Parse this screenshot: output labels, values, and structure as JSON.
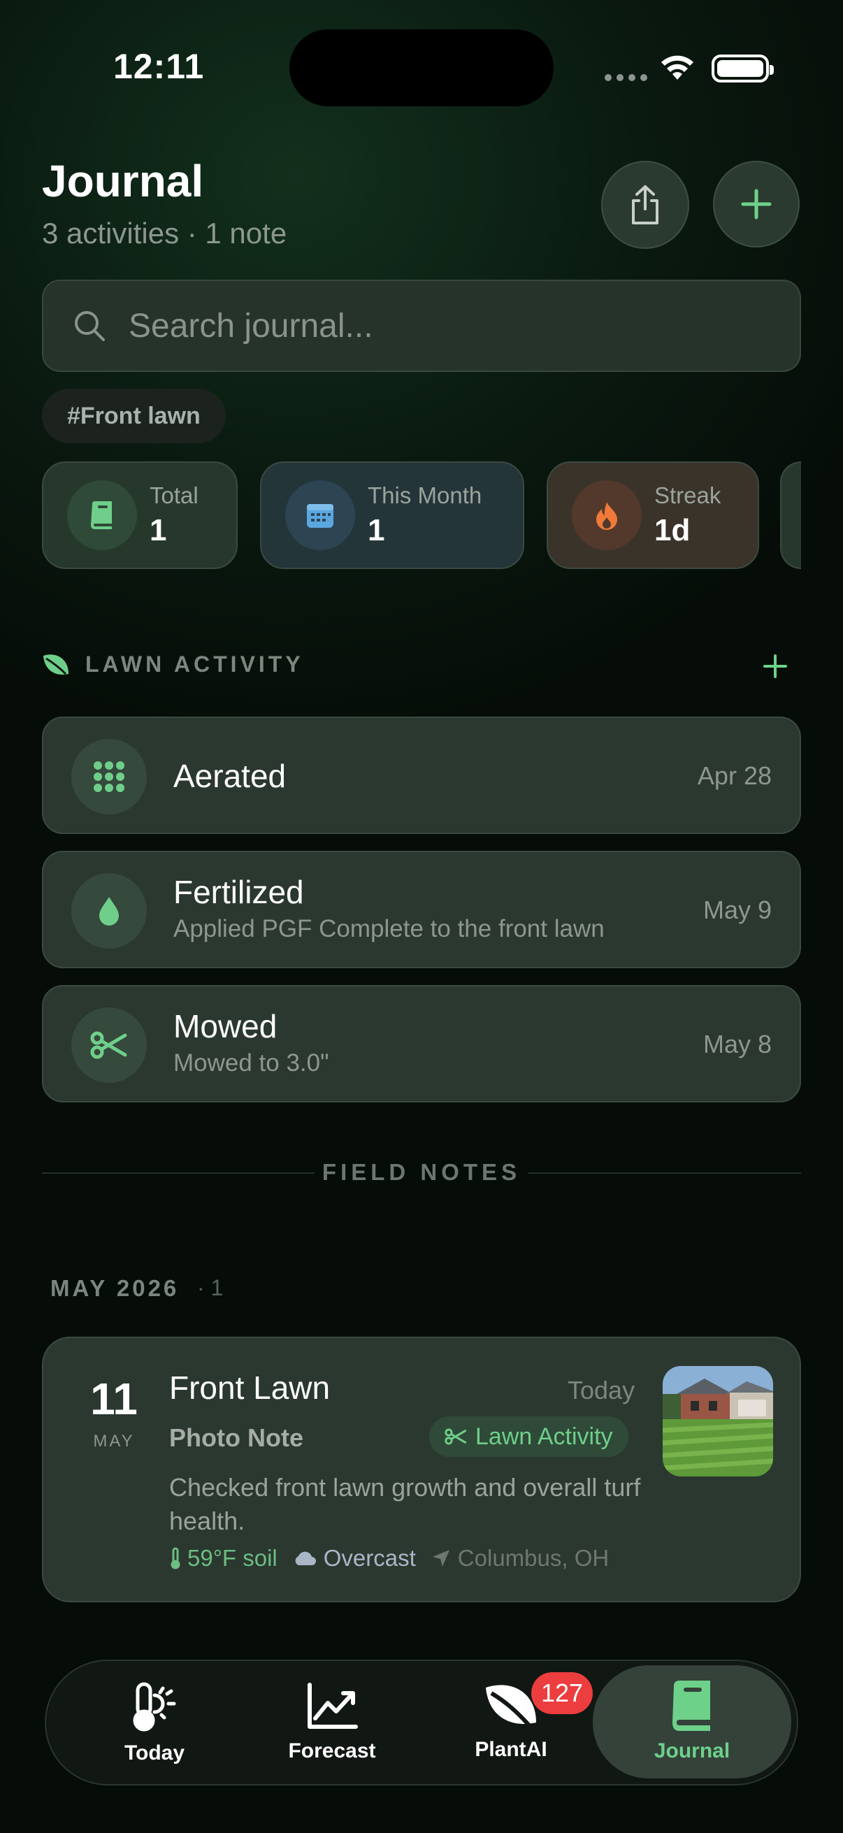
{
  "status_bar": {
    "time": "12:11"
  },
  "header": {
    "title": "Journal",
    "subtitle": "3 activities · 1 note"
  },
  "search": {
    "placeholder": "Search journal..."
  },
  "filter_tag": "#Front lawn",
  "stats": [
    {
      "label": "Total",
      "value": "1",
      "icon": "book-icon",
      "color": "#6fcf8a"
    },
    {
      "label": "This Month",
      "value": "1",
      "icon": "calendar-icon",
      "color": "#5aa7e0"
    },
    {
      "label": "Streak",
      "value": "1d",
      "icon": "flame-icon",
      "color": "#f07a3a"
    }
  ],
  "lawn_activity": {
    "title": "LAWN ACTIVITY",
    "items": [
      {
        "name": "Aerated",
        "description": "",
        "date": "Apr 28",
        "icon": "aerate-grid-icon"
      },
      {
        "name": "Fertilized",
        "description": "Applied PGF Complete to the front lawn",
        "date": "May 9",
        "icon": "drop-icon"
      },
      {
        "name": "Mowed",
        "description": "Mowed to 3.0\"",
        "date": "May 8",
        "icon": "scissors-icon"
      }
    ]
  },
  "field_notes": {
    "title": "FIELD NOTES",
    "month_label": "MAY 2026",
    "month_count": "· 1",
    "note": {
      "day": "11",
      "month": "MAY",
      "title": "Front Lawn",
      "when": "Today",
      "type": "Photo Note",
      "badge": "Lawn Activity",
      "text": "Checked front lawn growth and overall turf health.",
      "soil": "59°F soil",
      "weather": "Overcast",
      "location": "Columbus, OH"
    }
  },
  "tabs": [
    {
      "label": "Today",
      "icon": "thermometer-sun-icon"
    },
    {
      "label": "Forecast",
      "icon": "chart-trend-icon"
    },
    {
      "label": "PlantAI",
      "icon": "leaf-icon",
      "badge": "127"
    },
    {
      "label": "Journal",
      "icon": "book-icon",
      "active": true
    }
  ],
  "colors": {
    "accent": "#6ed18a",
    "badge": "#ec3d3f"
  }
}
